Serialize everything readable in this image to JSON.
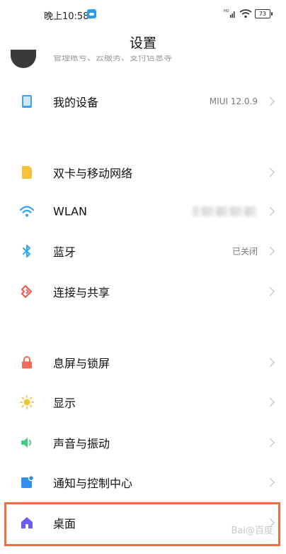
{
  "status_bar": {
    "time": "晚上10:58",
    "battery": "73"
  },
  "header": {
    "title": "设置"
  },
  "account": {
    "subtitle": "管理账号、云服务、支付信息等"
  },
  "items": [
    {
      "label": "我的设备",
      "value": "MIUI 12.0.9",
      "icon": "tablet-icon",
      "color": "#3aa3f5"
    },
    {
      "label": "双卡与移动网络",
      "value": "",
      "icon": "sim-card-icon",
      "color": "#f6c23a"
    },
    {
      "label": "WLAN",
      "value": "",
      "icon": "wifi-icon",
      "color": "#2fa4f0"
    },
    {
      "label": "蓝牙",
      "value": "已关闭",
      "icon": "bluetooth-icon",
      "color": "#2fa4f0"
    },
    {
      "label": "连接与共享",
      "value": "",
      "icon": "share-icon",
      "color": "#ef5f52"
    },
    {
      "label": "息屏与锁屏",
      "value": "",
      "icon": "lock-icon",
      "color": "#ef6b55"
    },
    {
      "label": "显示",
      "value": "",
      "icon": "sun-icon",
      "color": "#f6c23a"
    },
    {
      "label": "声音与振动",
      "value": "",
      "icon": "speaker-icon",
      "color": "#3ccf7e"
    },
    {
      "label": "通知与控制中心",
      "value": "",
      "icon": "notification-icon",
      "color": "#2f8ff0"
    },
    {
      "label": "桌面",
      "value": "",
      "icon": "home-icon",
      "color": "#6a5df2"
    }
  ],
  "watermark": "Bai@百度"
}
